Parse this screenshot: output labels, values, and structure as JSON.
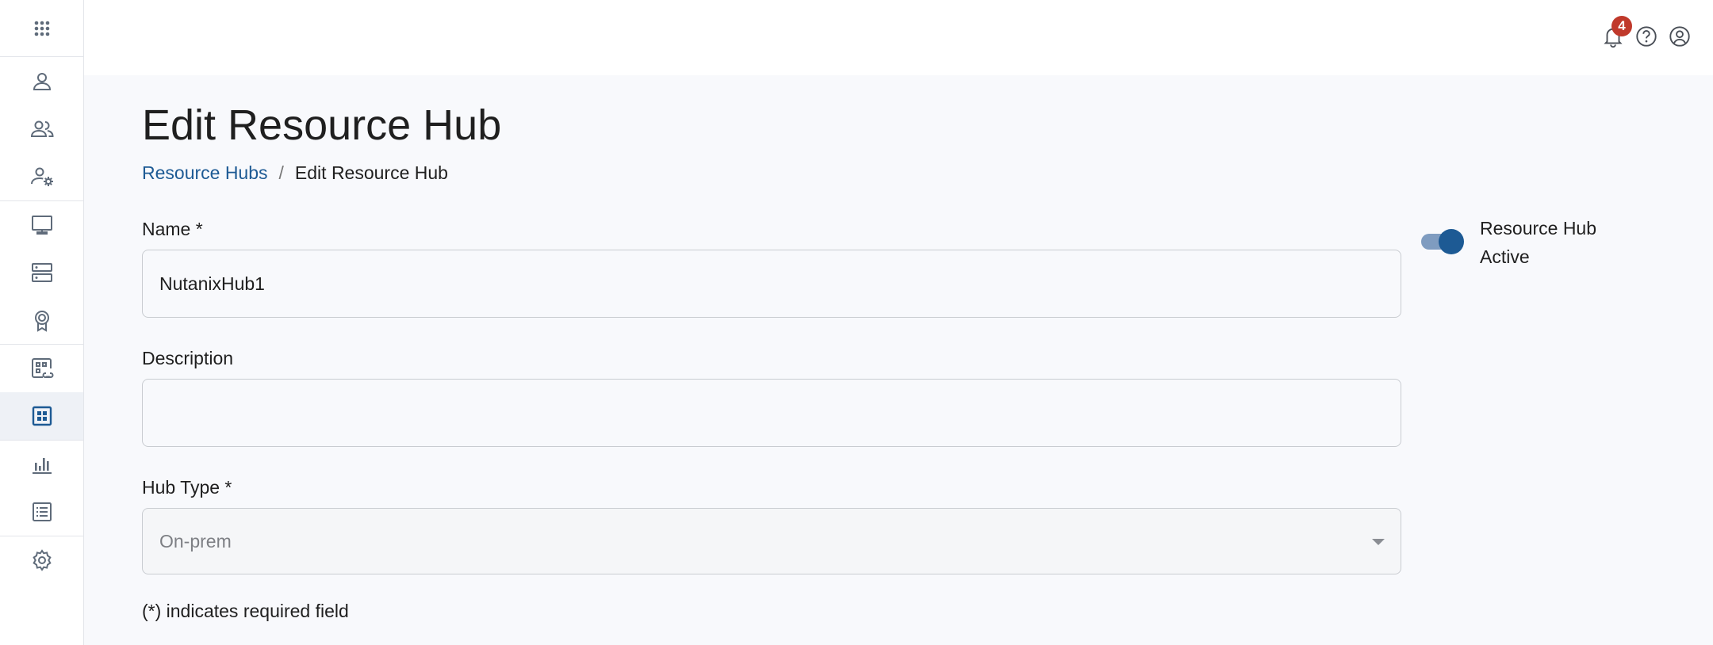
{
  "notifications": {
    "count": "4"
  },
  "page": {
    "title": "Edit Resource Hub",
    "breadcrumb": {
      "parent": "Resource Hubs",
      "separator": "/",
      "current": "Edit Resource Hub"
    }
  },
  "form": {
    "name": {
      "label": "Name *",
      "value": "NutanixHub1"
    },
    "description": {
      "label": "Description",
      "value": ""
    },
    "hub_type": {
      "label": "Hub Type *",
      "value": "On-prem"
    },
    "required_note": "(*) indicates required field"
  },
  "toggle": {
    "label": "Resource Hub Active",
    "on": true
  },
  "colors": {
    "accent": "#1d5a94",
    "badge": "#c0392b",
    "toggle_track": "#7f9cc0"
  },
  "sidebar": {
    "items": [
      {
        "icon": "apps-grid-icon"
      },
      {
        "icon": "user-icon"
      },
      {
        "icon": "users-icon"
      },
      {
        "icon": "user-settings-icon"
      },
      {
        "icon": "monitor-icon"
      },
      {
        "icon": "server-icon"
      },
      {
        "icon": "certificate-icon"
      },
      {
        "icon": "linked-apps-icon"
      },
      {
        "icon": "resource-hub-icon",
        "active": true
      },
      {
        "icon": "bar-chart-icon"
      },
      {
        "icon": "list-icon"
      },
      {
        "icon": "gear-icon"
      }
    ]
  }
}
